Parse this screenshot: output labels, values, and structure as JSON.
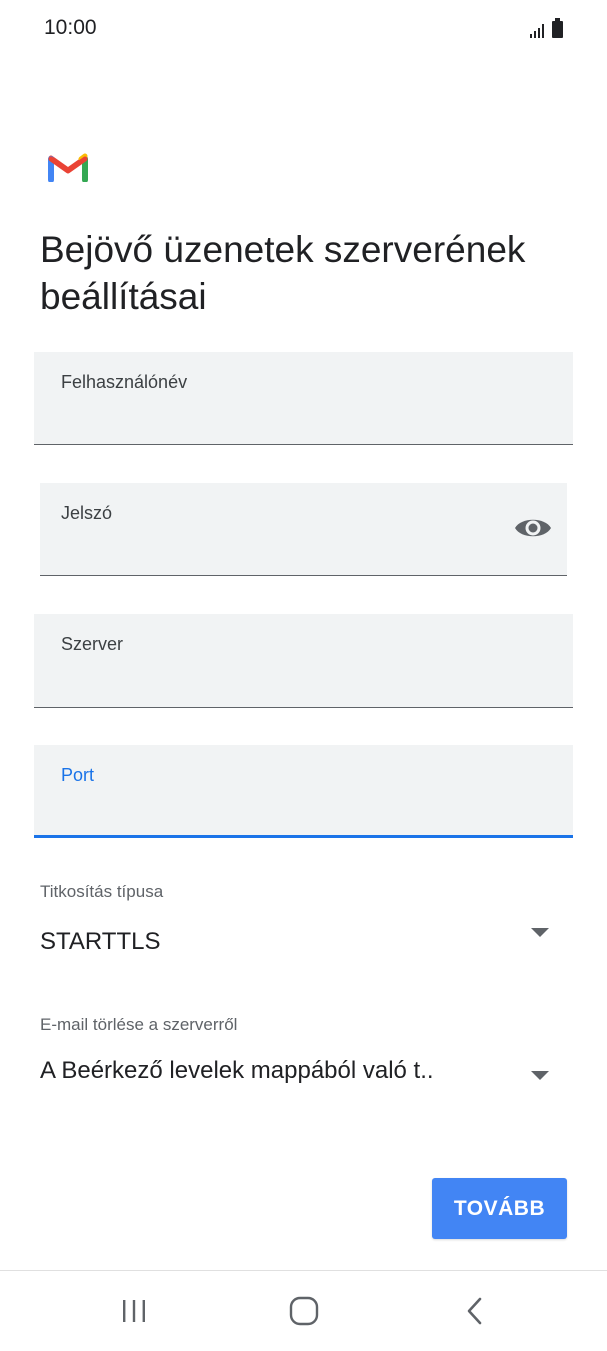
{
  "status_bar": {
    "time": "10:00",
    "icons": [
      "signal-icon",
      "battery-icon"
    ]
  },
  "app": {
    "logo": "gmail-logo",
    "brand_colors": {
      "blue": "#4285f4",
      "red": "#ea4335",
      "yellow": "#fbbc04",
      "green": "#34a853"
    }
  },
  "page": {
    "title": "Bejövő üzenetek szerverének beállításai"
  },
  "form": {
    "username": {
      "label": "Felhasználónév",
      "value": ""
    },
    "password": {
      "label": "Jelszó",
      "value": "",
      "toggle_icon": "eye-icon"
    },
    "server": {
      "label": "Szerver",
      "value": ""
    },
    "port": {
      "label": "Port",
      "value": "",
      "focused": true,
      "focus_color": "#1a73e8"
    },
    "encryption": {
      "label": "Titkosítás típusa",
      "value": "STARTTLS"
    },
    "delete_from_server": {
      "label": "E-mail törlése a szerverről",
      "value": "A Beérkező levelek mappából való t.."
    }
  },
  "actions": {
    "next_label": "TOVÁBB",
    "next_color": "#4285f4"
  },
  "nav_bar": {
    "items": [
      "recent-apps-icon",
      "home-icon",
      "back-icon"
    ]
  }
}
